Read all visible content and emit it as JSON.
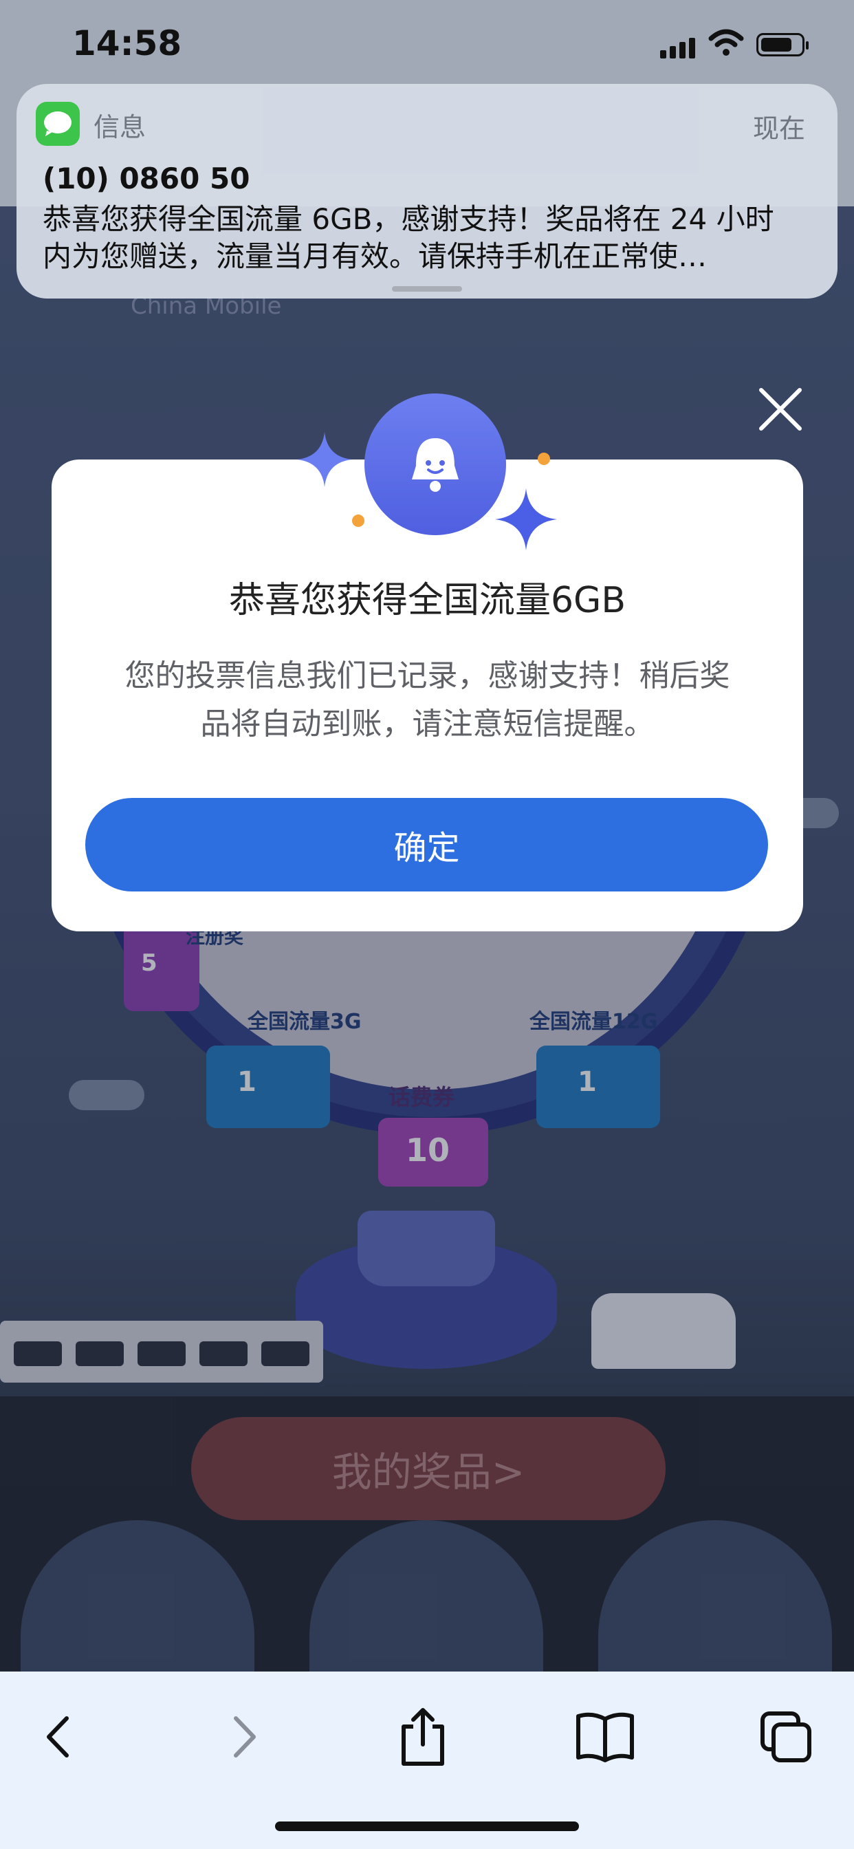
{
  "status_bar": {
    "time": "14:58"
  },
  "notification": {
    "app_name": "信息",
    "time": "现在",
    "sender": "(10) 0860 50",
    "body": "恭喜您获得全国流量 6GB，感谢支持！奖品将在 24 小时内为您赠送，流量当月有效。请保持手机在正常使…"
  },
  "background": {
    "brand": "China Mobile",
    "wheel_labels": [
      "话费券",
      "全国流量3G",
      "全国流量12G",
      "注册奖"
    ],
    "prize_values": [
      "5",
      "1",
      "10",
      "1"
    ],
    "my_prizes_button": "我的奖品>"
  },
  "modal": {
    "title": "恭喜您获得全国流量6GB",
    "text": "您的投票信息我们已记录，感谢支持！稍后奖品将自动到账，请注意短信提醒。",
    "ok_button": "确定"
  },
  "toolbar": {
    "icons": [
      "back-icon",
      "forward-icon",
      "share-icon",
      "bookmarks-icon",
      "tabs-icon"
    ]
  },
  "colors": {
    "primary_button": "#2d6fe0",
    "messages_green": "#3cc44b",
    "prize_button": "#7a3c3f"
  }
}
